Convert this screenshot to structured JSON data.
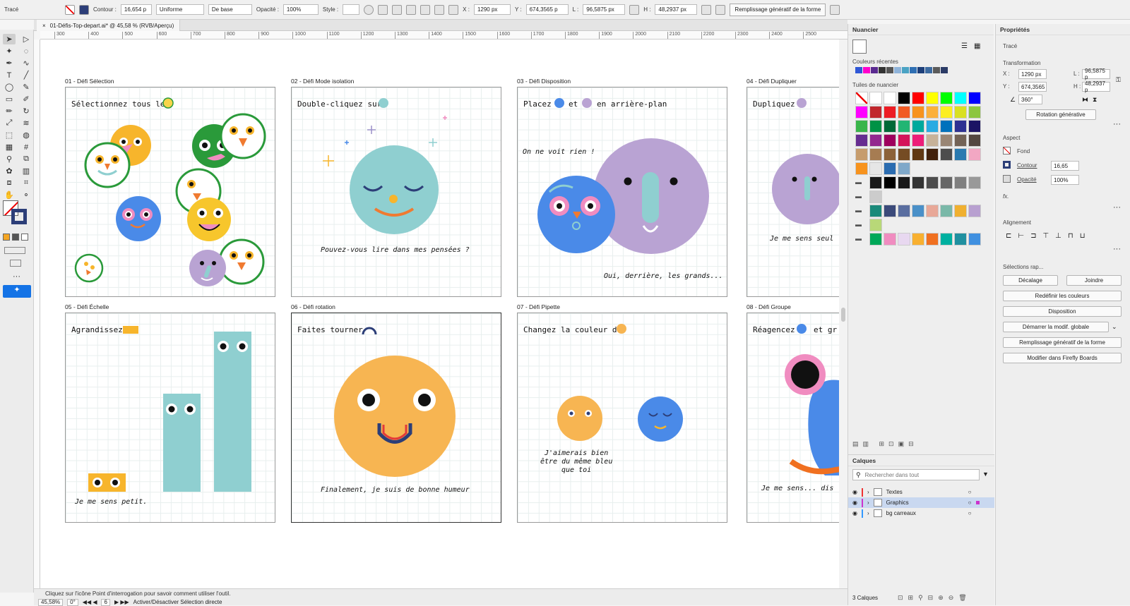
{
  "control_bar": {
    "object_type": "Tracé",
    "contour_label": "Contour :",
    "contour_value": "16,654 p",
    "profile": "Uniforme",
    "brush": "De base",
    "opacity_label": "Opacité :",
    "opacity_value": "100%",
    "style_label": "Style :",
    "x_label": "X :",
    "x_value": "1290 px",
    "y_label": "Y :",
    "y_value": "674,3565 p",
    "l_label": "L :",
    "l_value": "96,5875 px",
    "h_label": "H :",
    "h_value": "48,2937 px",
    "gen_fill": "Remplissage génératif de la forme"
  },
  "document": {
    "tab_title": "01-Défis-Top-depart.ai* @ 45,58 % (RVB/Aperçu)",
    "close": "×"
  },
  "ruler_ticks": [
    "300",
    "400",
    "500",
    "600",
    "700",
    "800",
    "900",
    "1000",
    "1100",
    "1200",
    "1300",
    "1400",
    "1500",
    "1600",
    "1700",
    "1800",
    "1900",
    "2000",
    "2100",
    "2200",
    "2300",
    "2400",
    "2500"
  ],
  "artboards": [
    {
      "label": "01 - Défi Sélection",
      "text1": "Sélectionnez tous les"
    },
    {
      "label": "02 - Défi Mode isolation",
      "text1": "Double-cliquez sur",
      "text2": "Pouvez-vous lire dans mes pensées ?"
    },
    {
      "label": "03 - Défi Disposition",
      "text1": "Placez",
      "text_and": "et",
      "text_bg": "en arrière-plan",
      "text2": "On ne voit rien !",
      "text3": "Oui, derrière, les grands..."
    },
    {
      "label": "04 - Défi Dupliquer",
      "text1": "Dupliquez",
      "text2": "Je me sens seul"
    },
    {
      "label": "05 - Défi Échelle",
      "text1": "Agrandissez",
      "text2": "Je me sens petit."
    },
    {
      "label": "06 - Défi rotation",
      "text1": "Faites tourner",
      "text2": "Finalement, je suis de bonne humeur"
    },
    {
      "label": "07 - Défi Pipette",
      "text1": "Changez la couleur de",
      "text2": "J'aimerais bien",
      "text3": "être du même bleu",
      "text4": "que toi"
    },
    {
      "label": "08 - Défi Groupe",
      "text1": "Réagencez",
      "text_and": "et gr",
      "text2": "Je me sens... dis"
    }
  ],
  "status": {
    "help": "Cliquez sur l'icône Point d'interrogation pour savoir comment utiliser l'outil.",
    "zoom": "45,58%",
    "rotation": "0°",
    "artboard_num": "6",
    "mode": "Activer/Désactiver Sélection directe"
  },
  "swatches_panel": {
    "title": "Nuancier",
    "recent_label": "Couleurs récentes",
    "tiles_label": "Tuiles de nuancier",
    "recent": [
      "#2f57d6",
      "#ff00cc",
      "#5a2a90",
      "#333333",
      "#555555",
      "#8fb3d9",
      "#4aa3c4",
      "#2f6fb3",
      "#1d3f7a",
      "#3c6aa0",
      "#5b5b5b",
      "#2b3b66"
    ],
    "rows": [
      [
        "#ffffff",
        "#ffffff",
        "#ffffff",
        "#000000",
        "#ff0000",
        "#ffff00",
        "#00ff00",
        "#00ffff",
        "#0000ff"
      ],
      [
        "#ff00ff",
        "#c1272d",
        "#ed1c24",
        "#f15a24",
        "#f7931e",
        "#fbb03b",
        "#fcee21",
        "#d9e021",
        "#8cc63f"
      ],
      [
        "#39b54a",
        "#009245",
        "#006837",
        "#22b573",
        "#00a99d",
        "#29abe2",
        "#0071bc",
        "#2e3192",
        "#1b1464"
      ],
      [
        "#662d91",
        "#93278f",
        "#9e005d",
        "#d4145a",
        "#ed1e79",
        "#c7b299",
        "#998675",
        "#736357",
        "#534741"
      ],
      [
        "#c69c6d",
        "#a67c52",
        "#8c6239",
        "#754c24",
        "#603813",
        "#42210b",
        "#4d4d4d",
        "#2a7ab0",
        "#f2a7c3"
      ],
      [
        "#f7931e",
        "#e6e6e6",
        "#2b6cb0",
        "#7fa8c9"
      ],
      [
        "#1a1a1a",
        "#000000",
        "#1a1a1a",
        "#333333",
        "#4d4d4d",
        "#666666",
        "#808080",
        "#999999"
      ],
      [
        "#cccccc"
      ],
      [
        "#1a8a7a",
        "#3b4a7a",
        "#5a6ea0",
        "#4a90c8",
        "#e8a898",
        "#7ab8a8",
        "#f0b030",
        "#b8a0d0"
      ],
      [
        "#b8d878"
      ],
      [
        "#00a859",
        "#f08cc0",
        "#e8d8f0",
        "#f8b030",
        "#f07020",
        "#00b0a0",
        "#2090a0",
        "#4090e0"
      ]
    ]
  },
  "layers_panel": {
    "title": "Calques",
    "search_placeholder": "Rechercher dans tout",
    "layers": [
      "Textes",
      "Graphics",
      "bg carreaux"
    ],
    "count": "3 Calques"
  },
  "properties_panel": {
    "title": "Propriétés",
    "object": "Tracé",
    "transform": "Transformation",
    "x": "1290 px",
    "y": "674,3565",
    "l": "96,5875 p",
    "h": "48,2937 p",
    "angle": "360°",
    "rotation_gen": "Rotation générative",
    "aspect": "Aspect",
    "fill": "Fond",
    "stroke": "Contour",
    "stroke_val": "16,65",
    "opacity": "Opacité",
    "opacity_val": "100%",
    "fx": "fx.",
    "align": "Alignement",
    "quick": "Sélections rap...",
    "offset": "Décalage",
    "join": "Joindre",
    "recolor": "Redéfinir les couleurs",
    "arrange": "Disposition",
    "global": "Démarrer la modif. globale",
    "genfill": "Remplissage génératif de la forme",
    "firefly": "Modifier dans Firefly Boards"
  }
}
